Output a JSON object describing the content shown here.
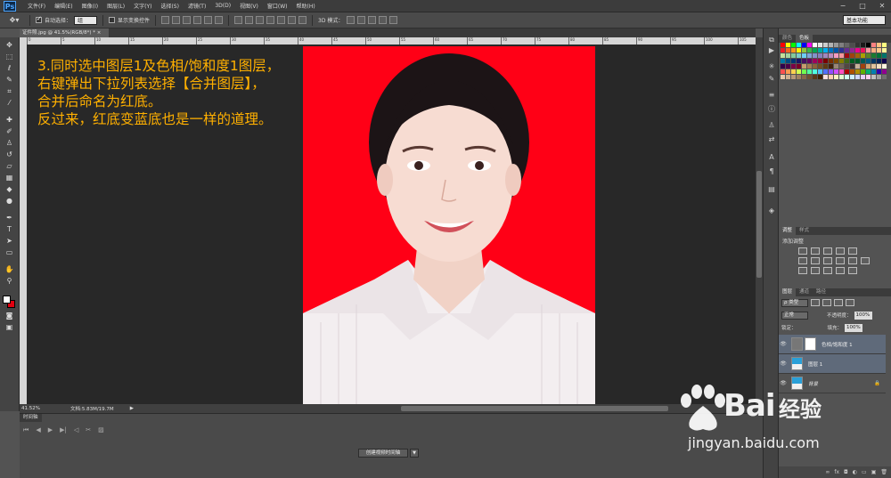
{
  "app": {
    "logo": "Ps"
  },
  "menu": [
    "文件(F)",
    "编辑(E)",
    "图像(I)",
    "图层(L)",
    "文字(Y)",
    "选择(S)",
    "滤镜(T)",
    "3D(D)",
    "视图(V)",
    "窗口(W)",
    "帮助(H)"
  ],
  "options": {
    "auto_select_label": "自动选择：",
    "auto_select_value": "组",
    "show_transform_label": "显示变换控件",
    "mode_3d_label": "3D 模式：",
    "workspace": "基本功能"
  },
  "document": {
    "tab_label": "证件照.jpg @ 41.5%(RGB/8*) * ×"
  },
  "ruler_ticks": [
    "0",
    "5",
    "10",
    "15",
    "20",
    "25",
    "30",
    "35",
    "40",
    "45",
    "50",
    "55",
    "60",
    "65",
    "70",
    "75",
    "80",
    "85",
    "90",
    "95",
    "100",
    "105"
  ],
  "annotation": {
    "lines": [
      "3.同时选中图层1及色相/饱和度1图层，",
      "右键弹出下拉列表选择【合并图层】，",
      "合并后命名为红底。",
      "反过来，红底变蓝底也是一样的道理。"
    ],
    "color": "#ffb000"
  },
  "status": {
    "zoom": "41.52%",
    "doc_info": "文档:5.83M/19.7M"
  },
  "timeline": {
    "tab_label": "时间轴",
    "create_button": "创建视频时间轴"
  },
  "panels": {
    "top_tabs": [
      "颜色",
      "色板"
    ],
    "adjust_tabs": [
      "调整",
      "样式"
    ],
    "adjust_title": "添加调整",
    "layer_tabs": [
      "图层",
      "通道",
      "路径"
    ],
    "kind_label": "ρ 类型",
    "blend_mode": "正常",
    "opacity_label": "不透明度：",
    "opacity_value": "100%",
    "lock_label": "锁定：",
    "fill_label": "填充：",
    "fill_value": "100%",
    "layers": [
      {
        "name": "色相/饱和度 1",
        "selected": true
      },
      {
        "name": "图层 1",
        "selected": true
      },
      {
        "name": "背景",
        "selected": false
      }
    ]
  },
  "watermark": {
    "brand": "Bai",
    "brand_cn": "经验",
    "url": "jingyan.baidu.com"
  }
}
